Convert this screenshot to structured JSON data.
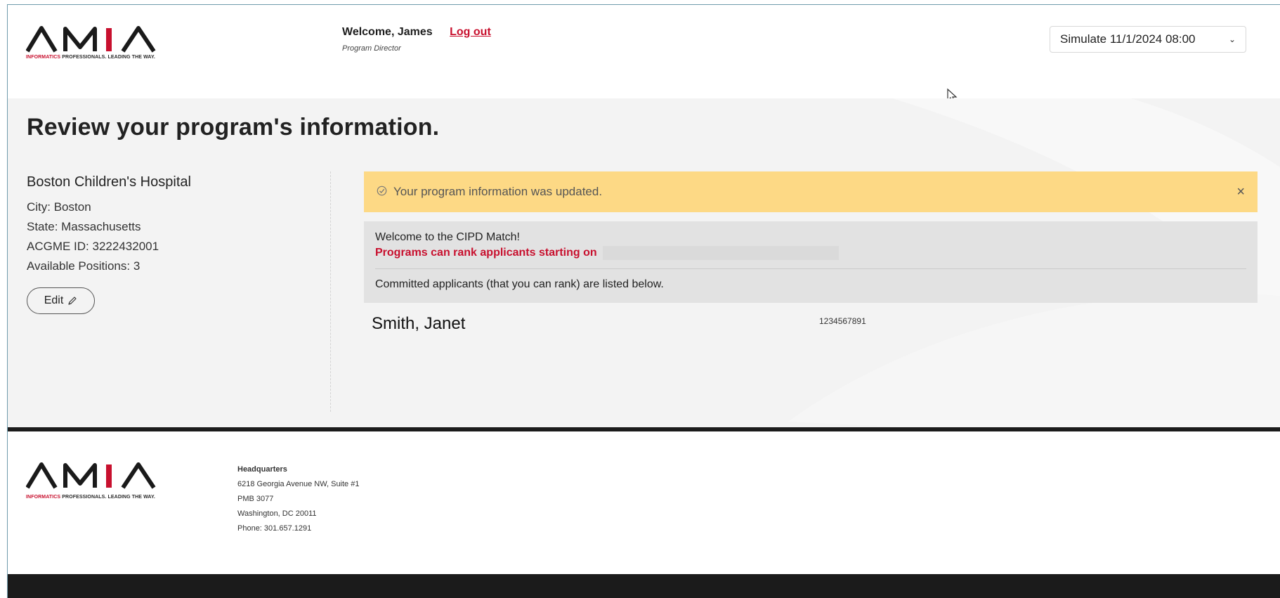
{
  "brand": {
    "logo_text": "AMIA",
    "tagline_accent": "INFORMATICS",
    "tagline_rest": "PROFESSIONALS. LEADING THE WAY.",
    "accent_color": "#c8102e"
  },
  "header": {
    "welcome": "Welcome, James",
    "logout": "Log out",
    "role": "Program Director",
    "simulate": "Simulate 11/1/2024 08:00"
  },
  "page": {
    "title": "Review your program's information."
  },
  "program": {
    "name": "Boston Children's Hospital",
    "city": "City: Boston",
    "state": "State: Massachusetts",
    "acgme": "ACGME ID: 3222432001",
    "positions": "Available Positions: 3",
    "edit_label": "Edit"
  },
  "alert": {
    "message": "Your program information was updated.",
    "close": "×"
  },
  "info": {
    "welcome": "Welcome to the CIPD Match!",
    "ranking": "Programs can rank applicants starting on",
    "committed": "Committed applicants (that you can rank) are listed below."
  },
  "applicants": [
    {
      "name": "Smith, Janet",
      "id": "1234567891"
    }
  ],
  "footer": {
    "hq_title": "Headquarters",
    "address1": "6218 Georgia Avenue NW, Suite #1",
    "address2": "PMB 3077",
    "address3": "Washington, DC 20011",
    "phone": "Phone: 301.657.1291"
  },
  "icons": {
    "check": "check-circle-icon",
    "close": "close-icon",
    "edit": "pencil-icon",
    "dropdown": "chevron-down-icon"
  }
}
